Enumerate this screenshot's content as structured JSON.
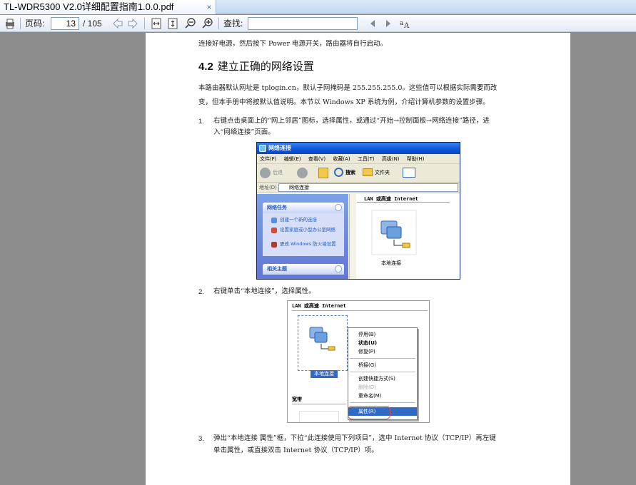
{
  "tab": {
    "title": "TL-WDR5300  V2.0详细配置指南1.0.0.pdf",
    "close": "×"
  },
  "toolbar": {
    "page_label": "页码:",
    "page_value": "13",
    "page_total": "/ 105",
    "find_label": "查找:",
    "icons": [
      "printer-icon",
      "prev-page-icon",
      "next-page-icon",
      "fit-width-icon",
      "fit-page-icon",
      "zoom-out-icon",
      "zoom-in-icon",
      "find-prev-icon",
      "find-next-icon",
      "match-case-icon"
    ]
  },
  "doc": {
    "intro_line": "连接好电源，然后按下 Power 电源开关，路由器将自行启动。",
    "section_num": "4.2",
    "section_title": "建立正确的网络设置",
    "para1_a": "本路由器默认网址是  tplogin.cn，默认子网掩码是  255.255.255.0。这些值可以根据实际需要而改",
    "para1_b": "变，但本手册中将按默认值说明。本节以 Windows XP 系统为例，介绍计算机参数的设置步骤。",
    "step1_num": "1.",
    "step1_a": "右键点击桌面上的“网上邻居”图标，选择属性，或通过“开始→控制面板→网络连接”路径，进",
    "step1_b": "入“网络连接”页面。",
    "step2_num": "2.",
    "step2": "右键单击“本地连接”，选择属性。",
    "step3_num": "3.",
    "step3_a": "弹出“本地连接  属性”框，下拉“此连接使用下列项目”，选中  Internet  协议（TCP/IP）再左键",
    "step3_b": "单击属性，或直接双击 Internet  协议（TCP/IP）项。"
  },
  "shot1": {
    "title": "网络连接",
    "menu": [
      "文件(F)",
      "编辑(E)",
      "查看(V)",
      "收藏(A)",
      "工具(T)",
      "高级(N)",
      "帮助(H)"
    ],
    "back": "后退",
    "search": "搜索",
    "folders": "文件夹",
    "addr_label": "地址(D)",
    "addr_value": "网络连接",
    "panel1": "网络任务",
    "tasks": [
      "创建一个新的连接",
      "设置家庭或小型办公室网络",
      "更改 Windows 防火墙设置"
    ],
    "panel2": "相关主题",
    "group": "LAN 或高速 Internet",
    "icon_label": "本地连接"
  },
  "shot2": {
    "group1": "LAN 或高速 Internet",
    "group2": "宽带",
    "icon_label": "本地连接",
    "menu": {
      "disable": "停用(B)",
      "status": "状态(U)",
      "repair": "修复(P)",
      "bridge": "桥接(G)",
      "shortcut": "创建快捷方式(S)",
      "delete": "删除(D)",
      "rename": "重命名(M)",
      "properties": "属性(R)"
    }
  }
}
